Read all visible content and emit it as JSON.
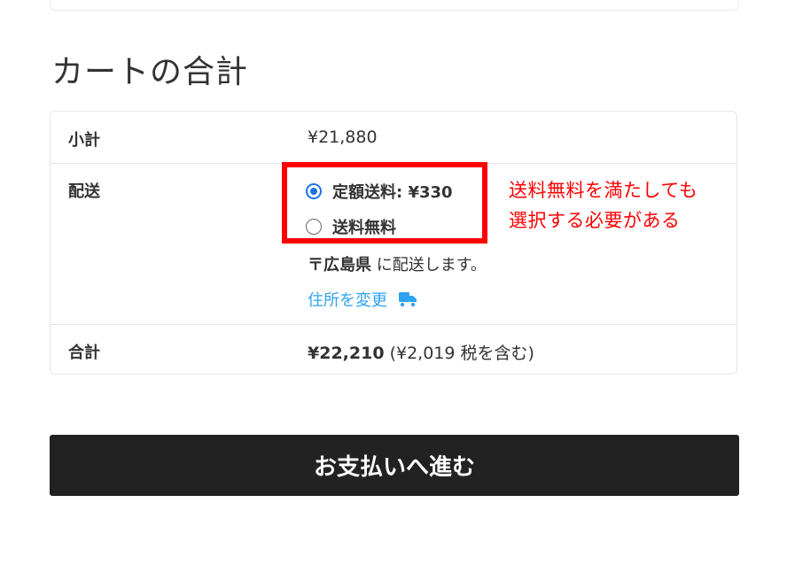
{
  "cart_totals": {
    "title": "カートの合計",
    "subtotal": {
      "label": "小計",
      "value": "¥21,880"
    },
    "shipping": {
      "label": "配送",
      "methods": [
        {
          "label": "定額送料: ¥330",
          "selected": true
        },
        {
          "label": "送料無料",
          "selected": false
        }
      ],
      "destination_region": "〒広島県",
      "destination_suffix": " に配送します。",
      "change_address_label": "住所を変更",
      "change_address_icon": "truck-icon"
    },
    "total": {
      "label": "合計",
      "value": "¥22,210",
      "tax_note": "(¥2,019 税を含む)"
    }
  },
  "annotation": {
    "lines": [
      "送料無料を満たしても",
      "選択する必要がある"
    ],
    "color": "#ff0000"
  },
  "checkout": {
    "label": "お支払いへ進む"
  },
  "colors": {
    "link": "#2ea3f2",
    "radio_accent": "#1a73e8",
    "button_bg": "#222222"
  }
}
